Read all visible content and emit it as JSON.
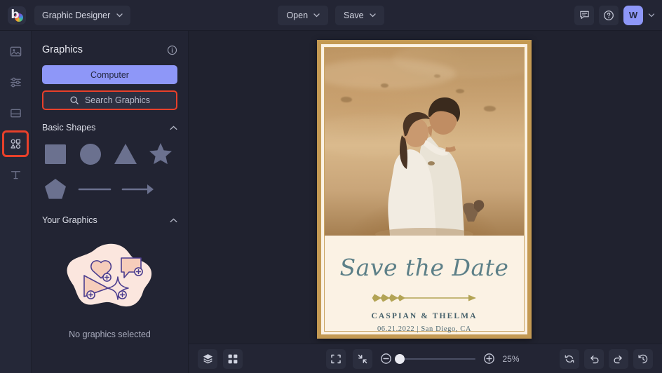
{
  "app": {
    "logo_letter": "b",
    "project_name": "Graphic Designer",
    "open_label": "Open",
    "save_label": "Save",
    "avatar_initial": "W",
    "chevron": "⌄"
  },
  "rail": {
    "items": [
      {
        "name": "image-tool",
        "icon": "image-icon",
        "active": false
      },
      {
        "name": "edit-tool",
        "icon": "sliders-icon",
        "active": false
      },
      {
        "name": "frames-tool",
        "icon": "frame-icon",
        "active": false
      },
      {
        "name": "graphics-tool",
        "icon": "shapes-icon",
        "active": true
      },
      {
        "name": "text-tool",
        "icon": "text-icon",
        "active": false
      }
    ]
  },
  "panel": {
    "title": "Graphics",
    "info_icon": "info-icon",
    "computer_button": "Computer",
    "search_placeholder": "Search Graphics",
    "search_icon": "search-icon",
    "sections": [
      {
        "title": "Basic Shapes",
        "collapsed": false,
        "shapes": [
          {
            "name": "square-shape",
            "label": "Square"
          },
          {
            "name": "circle-shape",
            "label": "Circle"
          },
          {
            "name": "triangle-shape",
            "label": "Triangle"
          },
          {
            "name": "star-shape",
            "label": "Star"
          },
          {
            "name": "pentagon-shape",
            "label": "Pentagon"
          },
          {
            "name": "line-shape",
            "label": "Line"
          },
          {
            "name": "arrow-shape",
            "label": "Arrow"
          }
        ]
      },
      {
        "title": "Your Graphics",
        "collapsed": false,
        "empty_text": "No graphics selected"
      }
    ]
  },
  "canvas": {
    "card": {
      "headline": "Save the Date",
      "names": "CASPIAN & THELMA",
      "details": "06.21.2022 | San Diego, CA",
      "ornament": "arrow-ornament",
      "photo_alt": "couple-embracing-in-desert-photo"
    }
  },
  "bottombar": {
    "layers_icon": "layers-icon",
    "grid_icon": "grid-icon",
    "fit_icon": "fit-screen-icon",
    "shrink_icon": "shrink-icon",
    "zoom_out_icon": "zoom-out-icon",
    "zoom_in_icon": "zoom-in-icon",
    "zoom_value": "25%",
    "reset_icon": "reset-icon",
    "undo_icon": "undo-icon",
    "redo_icon": "redo-icon",
    "history_icon": "history-icon"
  },
  "colors": {
    "accent_purple": "#8e97f8",
    "highlight_red": "#e8402a",
    "panel_bg": "#222433",
    "topbar_bg": "#232534",
    "card_cream": "#fbf2e4",
    "card_gold": "#c49a53",
    "headline_teal": "#5d8088",
    "ornament_gold": "#b3a455"
  }
}
